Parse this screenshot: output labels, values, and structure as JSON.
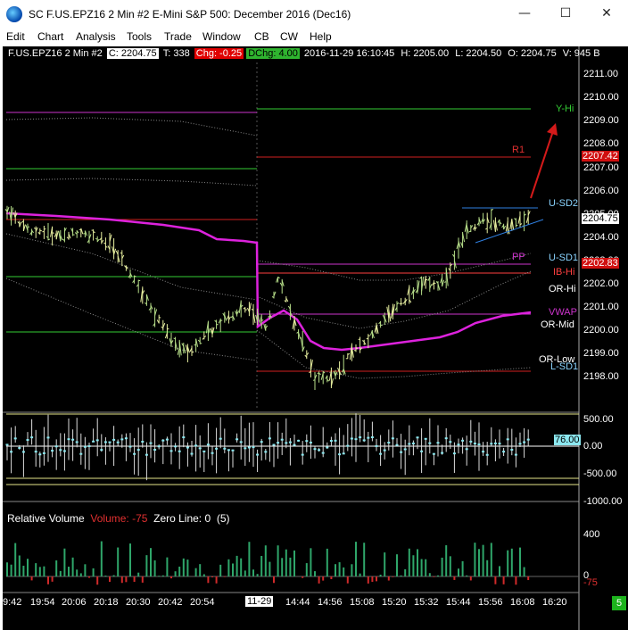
{
  "window": {
    "title": "SC F.US.EPZ16  2 Min   #2  E-Mini S&P 500: December 2016 (Dec16)",
    "controls": {
      "minimize": "—",
      "maximize": "☐",
      "close": "✕"
    }
  },
  "menu": [
    "Edit",
    "Chart",
    "Analysis",
    "Tools",
    "Trade",
    "Window",
    "CB",
    "CW",
    "Help"
  ],
  "header": {
    "symbol": "F.US.EPZ16  2 Min  #2",
    "close": "C: 2204.75",
    "trades": "T: 338",
    "change": "Chg: -0.25",
    "dchange": "DChg: 4.00",
    "datetime": "2016-11-29  16:10:45",
    "high": "H: 2205.00",
    "low": "L: 2204.50",
    "open": "O: 2204.75",
    "volume": "V: 945 B"
  },
  "price_scale": [
    "2211.00",
    "2210.00",
    "2209.00",
    "2208.00",
    "2207.00",
    "2206.00",
    "2205.00",
    "2204.00",
    "2203.00",
    "2202.00",
    "2201.00",
    "2200.00",
    "2199.00",
    "2198.00"
  ],
  "price_tags": {
    "r1": {
      "text": "2207.42",
      "bg": "#d01010",
      "fg": "#ffffff"
    },
    "last": {
      "text": "2204.75",
      "bg": "#ffffff",
      "fg": "#000000"
    },
    "pp": {
      "text": "2202.83",
      "bg": "#d01010",
      "fg": "#ffffff"
    }
  },
  "levels": {
    "y_hi": "Y-Hi",
    "r1": "R1",
    "u_sd2": "U-SD2",
    "u_sd1": "U-SD1",
    "pp": "PP",
    "ib_hi": "IB-Hi",
    "or_hi": "OR-Hi",
    "vwap": "VWAP",
    "or_mid": "OR-Mid",
    "or_low": "OR-Low",
    "l_sd1": "L-SD1"
  },
  "level_colors": {
    "y_hi": "#33cc33",
    "r1": "#d02020",
    "u_sd2": "#8ad4ff",
    "u_sd1": "#8ad4ff",
    "pp": "#cc33cc",
    "ib_hi": "#ff4040",
    "or_hi": "#ffffff",
    "vwap": "#cc33cc",
    "or_mid": "#ffffff",
    "or_low": "#ffffff",
    "l_sd1": "#8ad4ff"
  },
  "oscillator": {
    "scale": [
      "500.00",
      "0.00",
      "-500.00",
      "-1000.00"
    ],
    "current": "76.00"
  },
  "relative_volume": {
    "title": "Relative Volume",
    "volume_label": "Volume: -75",
    "zero_line": "Zero Line: 0",
    "period": "(5)",
    "scale": [
      "400",
      "0",
      "-75"
    ]
  },
  "time_axis": [
    "9:42",
    "19:54",
    "20:06",
    "20:18",
    "20:30",
    "20:42",
    "20:54",
    "11-29",
    "14:44",
    "14:56",
    "15:08",
    "15:20",
    "15:32",
    "15:44",
    "15:56",
    "16:08",
    "16:20"
  ],
  "status": "5"
}
